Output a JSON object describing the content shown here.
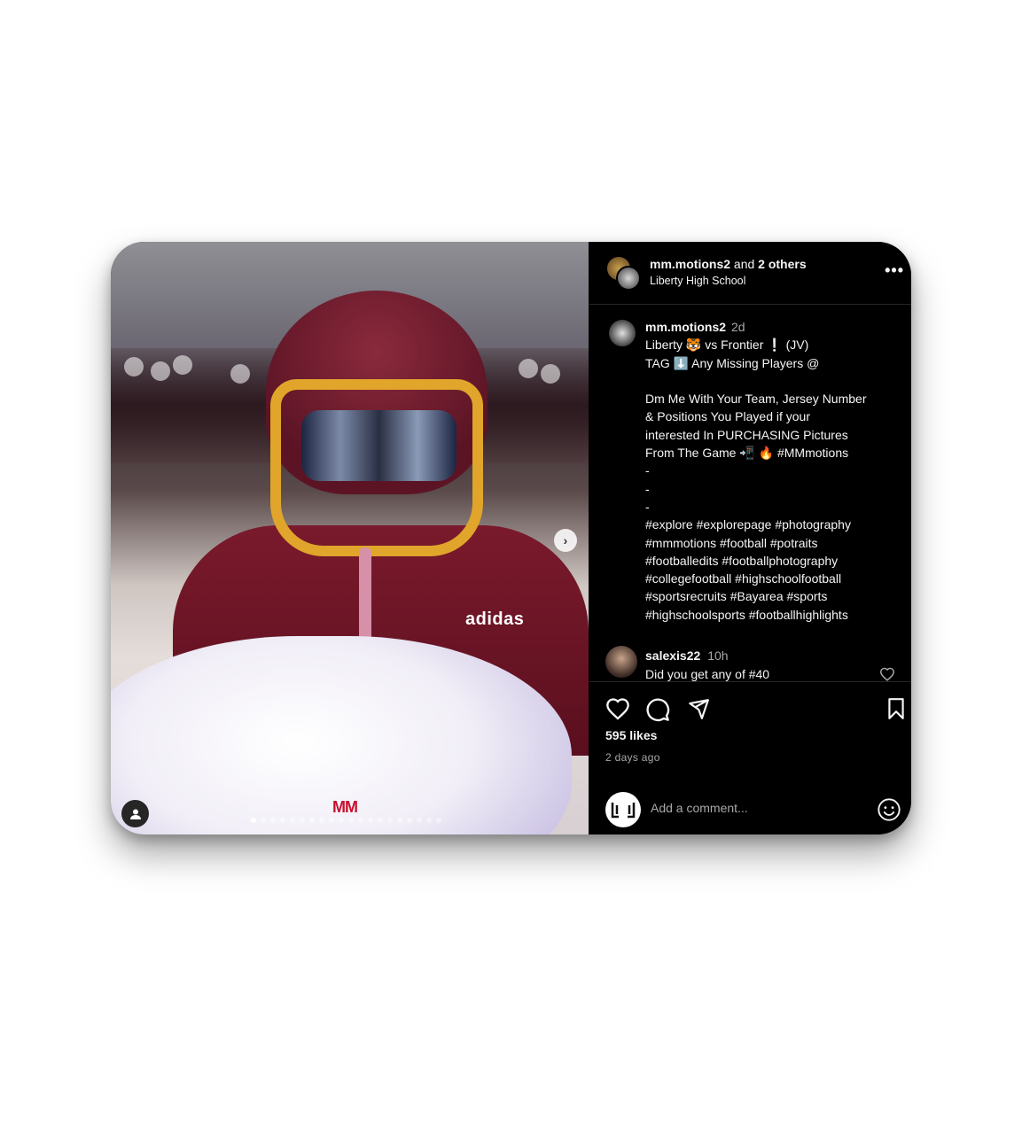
{
  "header": {
    "owner": "mm.motions2",
    "and_text": "and",
    "others": "2 others",
    "location": "Liberty High School",
    "more_label": "..."
  },
  "caption": {
    "username": "mm.motions2",
    "time": "2d",
    "lines": [
      "Liberty 🐯 vs Frontier ❕ (JV)",
      "TAG ⬇️ Any Missing Players @",
      "",
      "Dm Me With Your Team, Jersey Number",
      "& Positions You Played if your",
      "interested In PURCHASING Pictures",
      "From The Game 📲 🔥 #MMmotions",
      "-",
      "-",
      "-",
      "#explore #explorepage #photography",
      "#mmmotions #football #potraits",
      "#footballedits #footballphotography",
      "#collegefootball #highschoolfootball",
      "#sportsrecruits #Bayarea #sports",
      "#highschoolsports #footballhighlights"
    ]
  },
  "comment": {
    "username": "salexis22",
    "time": "10h",
    "text": "Did you get any of #40"
  },
  "photo": {
    "brand_text": "adidas",
    "watermark": "MM",
    "carousel_total": 20,
    "carousel_active_index": 0
  },
  "stats": {
    "likes": "595 likes",
    "posted": "2 days ago"
  },
  "comment_box": {
    "placeholder": "Add a comment..."
  },
  "icons": [
    "heart-icon",
    "comment-icon",
    "share-icon",
    "bookmark-icon",
    "emoji-icon",
    "user-tag-icon",
    "more-icon",
    "chevron-right-icon"
  ],
  "colors": {
    "panel_bg": "#000000",
    "text": "#f5f5f5",
    "muted": "#a8a8a8",
    "divider": "#262626"
  }
}
